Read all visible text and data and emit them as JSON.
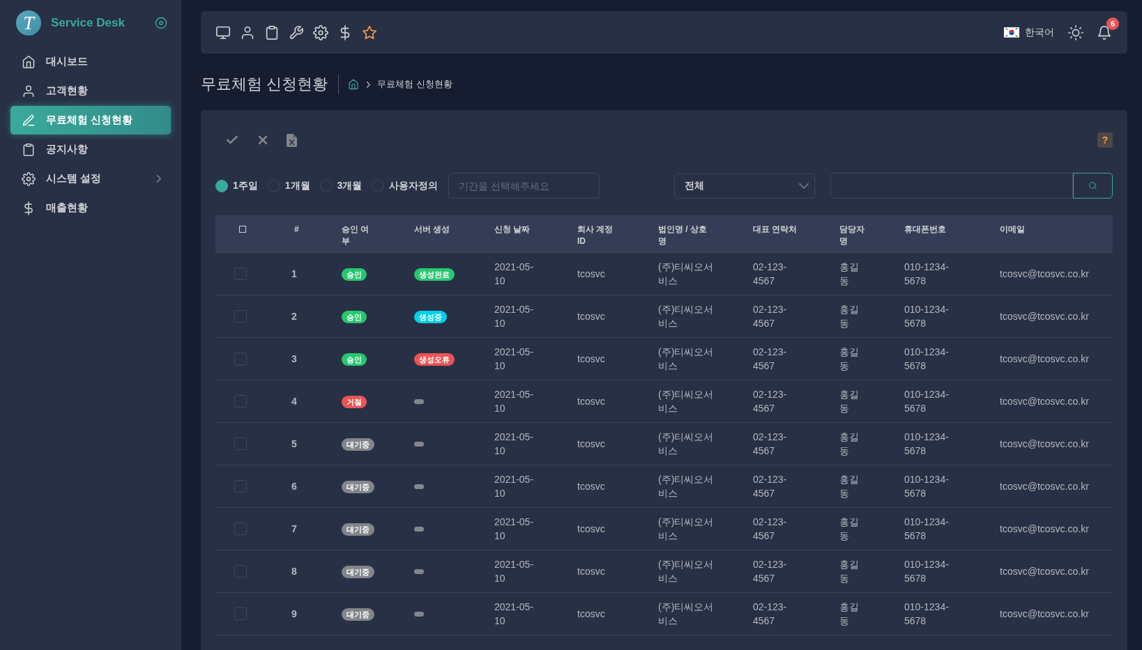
{
  "sidebar": {
    "brand": {
      "logo_letter": "T",
      "name": "Service Desk"
    },
    "items": [
      {
        "label": "대시보드",
        "kind": "link",
        "selected": false
      },
      {
        "label": "고객현황",
        "kind": "link",
        "selected": false
      },
      {
        "label": "무료체험 신청현황",
        "kind": "link",
        "selected": true
      },
      {
        "label": "공지사항",
        "kind": "link",
        "selected": false
      },
      {
        "label": "시스템 설정",
        "kind": "group",
        "selected": false,
        "expanded": false
      },
      {
        "label": "매출현황",
        "kind": "link",
        "selected": false
      }
    ]
  },
  "top_bar": {
    "language": "한국어",
    "notification_count": "6"
  },
  "page": {
    "title": "무료체험 신청현황",
    "breadcrumb": [
      "무료체험 신청현황"
    ]
  },
  "toolbar": {
    "help": "?"
  },
  "filters": {
    "periods": [
      {
        "label": "1주일",
        "selected": true
      },
      {
        "label": "1개월",
        "selected": false
      },
      {
        "label": "3개월",
        "selected": false
      },
      {
        "label": "사용자정의",
        "selected": false
      }
    ],
    "date_range": {
      "placeholder": "기간을 선택해주세요"
    },
    "category": {
      "value": "전체"
    }
  },
  "table": {
    "select_all": {
      "checked": false
    },
    "columns": [
      "#",
      "승인 여부",
      "서버 생성",
      "신청 날짜",
      "회사 계정 ID",
      "법인명 / 상호명",
      "대표 연락처",
      "담당자명",
      "휴대폰번호",
      "이메일"
    ],
    "rows": [
      {
        "checked": false,
        "number": "1",
        "approval": {
          "label": "승인",
          "color": "#28c76f"
        },
        "server": {
          "kind": "badge",
          "label": "생성완료",
          "color": "#28c76f"
        },
        "date": "2021-05-10",
        "account_id": "tcosvc",
        "company": "(주)티씨오서비스",
        "phone": "02-123-4567",
        "manager": "홍길동",
        "mobile": "010-1234-5678",
        "email": "tcosvc@tcosvc.co.kr"
      },
      {
        "checked": false,
        "number": "2",
        "approval": {
          "label": "승인",
          "color": "#28c76f"
        },
        "server": {
          "kind": "badge",
          "label": "생성중",
          "color": "#00cfe8"
        },
        "date": "2021-05-10",
        "account_id": "tcosvc",
        "company": "(주)티씨오서비스",
        "phone": "02-123-4567",
        "manager": "홍길동",
        "mobile": "010-1234-5678",
        "email": "tcosvc@tcosvc.co.kr"
      },
      {
        "checked": false,
        "number": "3",
        "approval": {
          "label": "승인",
          "color": "#28c76f"
        },
        "server": {
          "kind": "badge",
          "label": "생성오류",
          "color": "#ea5455"
        },
        "date": "2021-05-10",
        "account_id": "tcosvc",
        "company": "(주)티씨오서비스",
        "phone": "02-123-4567",
        "manager": "홍길동",
        "mobile": "010-1234-5678",
        "email": "tcosvc@tcosvc.co.kr"
      },
      {
        "checked": false,
        "number": "4",
        "approval": {
          "label": "거절",
          "color": "#ea5455"
        },
        "server": {
          "kind": "empty",
          "color": "#82868b"
        },
        "date": "2021-05-10",
        "account_id": "tcosvc",
        "company": "(주)티씨오서비스",
        "phone": "02-123-4567",
        "manager": "홍길동",
        "mobile": "010-1234-5678",
        "email": "tcosvc@tcosvc.co.kr"
      },
      {
        "checked": false,
        "number": "5",
        "approval": {
          "label": "대기중",
          "color": "#82868b"
        },
        "server": {
          "kind": "empty",
          "color": "#82868b"
        },
        "date": "2021-05-10",
        "account_id": "tcosvc",
        "company": "(주)티씨오서비스",
        "phone": "02-123-4567",
        "manager": "홍길동",
        "mobile": "010-1234-5678",
        "email": "tcosvc@tcosvc.co.kr"
      },
      {
        "checked": false,
        "number": "6",
        "approval": {
          "label": "대기중",
          "color": "#82868b"
        },
        "server": {
          "kind": "empty",
          "color": "#82868b"
        },
        "date": "2021-05-10",
        "account_id": "tcosvc",
        "company": "(주)티씨오서비스",
        "phone": "02-123-4567",
        "manager": "홍길동",
        "mobile": "010-1234-5678",
        "email": "tcosvc@tcosvc.co.kr"
      },
      {
        "checked": false,
        "number": "7",
        "approval": {
          "label": "대기중",
          "color": "#82868b"
        },
        "server": {
          "kind": "empty",
          "color": "#82868b"
        },
        "date": "2021-05-10",
        "account_id": "tcosvc",
        "company": "(주)티씨오서비스",
        "phone": "02-123-4567",
        "manager": "홍길동",
        "mobile": "010-1234-5678",
        "email": "tcosvc@tcosvc.co.kr"
      },
      {
        "checked": false,
        "number": "8",
        "approval": {
          "label": "대기중",
          "color": "#82868b"
        },
        "server": {
          "kind": "empty",
          "color": "#82868b"
        },
        "date": "2021-05-10",
        "account_id": "tcosvc",
        "company": "(주)티씨오서비스",
        "phone": "02-123-4567",
        "manager": "홍길동",
        "mobile": "010-1234-5678",
        "email": "tcosvc@tcosvc.co.kr"
      },
      {
        "checked": false,
        "number": "9",
        "approval": {
          "label": "대기중",
          "color": "#82868b"
        },
        "server": {
          "kind": "empty",
          "color": "#82868b"
        },
        "date": "2021-05-10",
        "account_id": "tcosvc",
        "company": "(주)티씨오서비스",
        "phone": "02-123-4567",
        "manager": "홍길동",
        "mobile": "010-1234-5678",
        "email": "tcosvc@tcosvc.co.kr"
      }
    ]
  }
}
